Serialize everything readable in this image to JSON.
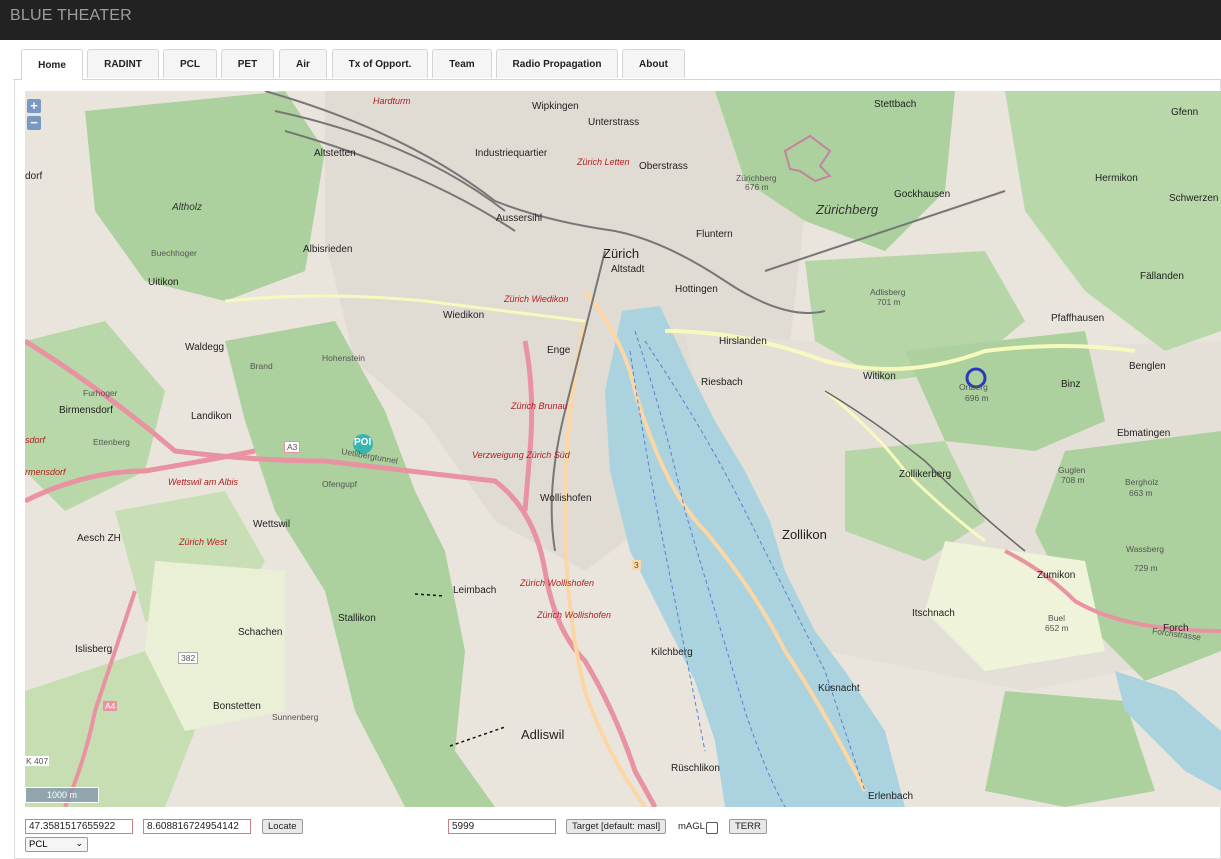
{
  "app": {
    "title": "BLUE THEATER"
  },
  "tabs": [
    {
      "label": "Home",
      "active": true
    },
    {
      "label": "RADINT"
    },
    {
      "label": "PCL"
    },
    {
      "label": "PET"
    },
    {
      "label": "Air"
    },
    {
      "label": "Tx of Opport."
    },
    {
      "label": "Team"
    },
    {
      "label": "Radio Propagation"
    },
    {
      "label": "About"
    }
  ],
  "map": {
    "zoom_in": "+",
    "zoom_out": "−",
    "scale": "1000 m",
    "poi": "POI",
    "colors": {
      "water": "#aad3df",
      "forest": "#add19e",
      "urban": "#e0dcd4",
      "railway": "#888888",
      "motorway": "#e892a2",
      "primary": "#fcd6a4",
      "marker": "#2a3ab8",
      "poi": "#3ab5b0"
    },
    "labels": {
      "zurich": "Zürich",
      "altstadt": "Altstadt",
      "wipkingen": "Wipkingen",
      "unterstrass": "Unterstrass",
      "oberstrass": "Oberstrass",
      "industriequartier": "Industriequartier",
      "altstetten": "Altstetten",
      "aussersihl": "Aussersihl",
      "fluntern": "Fluntern",
      "hottingen": "Hottingen",
      "hirslanden": "Hirslanden",
      "riesbach": "Riesbach",
      "enge": "Enge",
      "wiedikon": "Wiedikon",
      "albisrieden": "Albisrieden",
      "uitikon": "Uitikon",
      "waldegg": "Waldegg",
      "birmensdorf": "Birmensdorf",
      "landikon": "Landikon",
      "wollishofen": "Wollishofen",
      "zollikon": "Zollikon",
      "zollikerberg": "Zollikerberg",
      "witikon": "Witikon",
      "binz": "Binz",
      "pfaffhausen": "Pfaffhausen",
      "fallanden": "Fällanden",
      "benglen": "Benglen",
      "ebmatingen": "Ebmatingen",
      "zumikon": "Zumikon",
      "forch": "Forch",
      "itschnach": "Itschnach",
      "kusnacht": "Küsnacht",
      "kilchberg": "Kilchberg",
      "adliswil": "Adliswil",
      "ruschlikon": "Rüschlikon",
      "erlenbach": "Erlenbach",
      "leimbach": "Leimbach",
      "stallikon": "Stallikon",
      "schachen": "Schachen",
      "islisberg": "Islisberg",
      "bonstetten": "Bonstetten",
      "sunnenberg": "Sunnenberg",
      "wettswil": "Wettswil",
      "aesch": "Aesch ZH",
      "stettbach": "Stettbach",
      "gockhausen": "Gockhausen",
      "hermikon": "Hermikon",
      "gfenn": "Gfenn",
      "schwerzen": "Schwerzen",
      "zurichberg": "Zürichberg",
      "adlisberg": "Adlisberg",
      "adlisberg_h": "701 m",
      "oetliberg": "Ortberg",
      "oetliberg_h": "696 m",
      "guglen": "Guglen",
      "guglen_h": "708 m",
      "bergholz": "Bergholz",
      "bergholz_h": "663 m",
      "wassberg": "Wassberg",
      "wassberg_h": "729 m",
      "buel": "Buel",
      "buel_h": "652 m",
      "zurichberg_peak": "Zürichberg",
      "zurichberg_h": "676 m",
      "altholz": "Altholz",
      "buechhoger": "Buechhoger",
      "hohenstein": "Hohenstein",
      "brand": "Brand",
      "furhoger": "Furhoger",
      "ettenberg": "Ettenberg",
      "ofengupf": "Ofengupf",
      "uetlibergtunnel": "Uetlibergtunnel",
      "a3": "A3",
      "a4": "A4",
      "r382": "382",
      "r3": "3",
      "k407": "K 407",
      "forchstrasse": "Forchstrasse",
      "hardturm": "Hardturm",
      "zurich_letten": "Zürich Letten",
      "zurich_wiedikon": "Zürich Wiedikon",
      "zurich_brunau": "Zürich Brunau",
      "verzweigung": "Verzweigung Zürich Süd",
      "wollishofen_exit": "Zürich Wollishofen",
      "wollishofen_exit2": "Zürich Wollishofen",
      "wettswil_albis": "Wettswil am Albis",
      "zurich_west": "Zürich West",
      "sdorf": "sdorf",
      "rmensdorf": "rmensdorf",
      "dorf": "dorf"
    }
  },
  "controls": {
    "latitude": "47.3581517655922",
    "longitude": "8.608816724954142",
    "locate": "Locate",
    "altitude": "5999",
    "target": "Target [default: masl]",
    "magl": "mAGL",
    "terr": "TERR",
    "mode": "PCL"
  }
}
